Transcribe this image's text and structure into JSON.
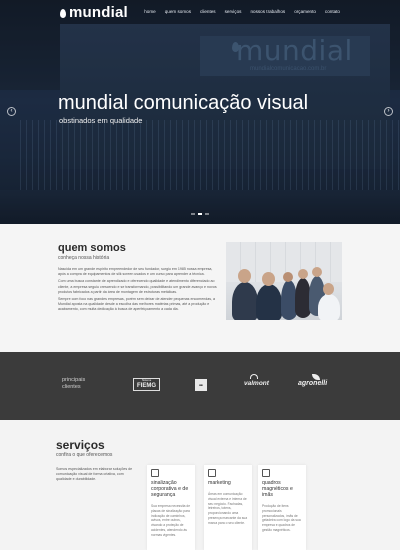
{
  "brand": {
    "name": "mundial",
    "logo_icon": "drop-icon"
  },
  "nav": {
    "items": [
      "home",
      "quem somos",
      "clientes",
      "serviços",
      "nossos trabalhos",
      "orçamento",
      "contato"
    ]
  },
  "hero": {
    "title": "mundial comunicação visual",
    "subtitle": "obstinados em qualidade",
    "sign_text": "mundial",
    "sign_sub": "mundialcomunicacao.com.br",
    "slides_total": 3,
    "active_slide": 1,
    "prev_icon": "chevron-left-icon",
    "next_icon": "chevron-right-icon"
  },
  "about": {
    "title": "quem somos",
    "subtitle": "conheça nossa história",
    "paragraphs": [
      "Nascida em um grande espírito empreendedor de seu fundador, surgiu em 1985 nossa empresa, após a compra de equipamentos de silk screen usados e um curso para aprender a técnica.",
      "Com uma busca constante de aprendizado e oferecendo qualidade e atendimento diferenciado ao cliente, a empresa seguiu crescendo e se transformando, possibilitando um grande avanço e novos produtos fabricados a partir da área de montagem de estruturas metálicas.",
      "Sempre com foco nas grandes empresas, porém sem deixar de atender pequenas encomendas, a Mundial aposta na qualidade desde a escolha das melhores matérias primas, até a produção e acabamento, com muita dedicação à busca de aperfeiçoamento a cada dia."
    ]
  },
  "clients": {
    "title_line1": "principais",
    "title_line2": "clientes",
    "fiemg_top": "Sistema",
    "fiemg_name": "FIEMG",
    "square_logo_text": "■■",
    "valmont": "valmont",
    "agronelli": "agronelli"
  },
  "services": {
    "title": "serviços",
    "subtitle": "confira o que oferecemos",
    "intro": "Somos especializados em elaborar soluções de comunicação visual de forma criativa, com qualidade e durabilidade.",
    "cards": [
      {
        "icon": "warning-sign-icon",
        "title": "sinalização corporativa e de segurança",
        "text": "Sua empresa necessita de placas de sinalização para indicação de caminhos, avisos, entre outros, visando a proteção de acidentes, atendendo às normas vigentes."
      },
      {
        "icon": "megaphone-icon",
        "title": "marketing",
        "text": "Áreas em comunicação visual externa e interna de seu negócio. Fachadas, letreiros, totens, proporcionando uma presença marcante da sua marca para o seu cliente."
      },
      {
        "icon": "magnet-icon",
        "title": "quadros magnéticos e imãs",
        "text": "Produção de itens promocionais personalizados, ímãs de geladeira com logo da sua empresa e quadros de gestão magnéticos."
      }
    ]
  }
}
